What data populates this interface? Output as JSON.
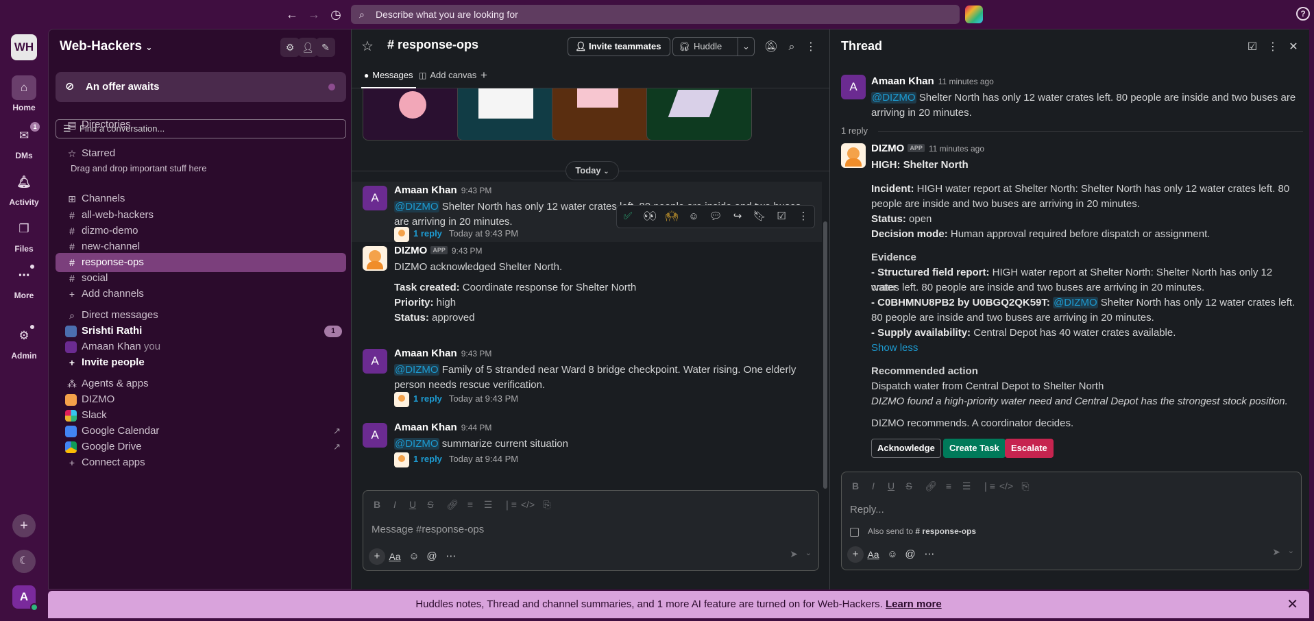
{
  "search": {
    "placeholder": "Describe what you are looking for"
  },
  "workspace": {
    "initials": "WH",
    "name": "Web-Hackers"
  },
  "rail": {
    "home": "Home",
    "dms": "DMs",
    "dms_badge": "1",
    "activity": "Activity",
    "files": "Files",
    "more": "More",
    "admin": "Admin",
    "user_initial": "A"
  },
  "sidebar": {
    "offer": "An offer awaits",
    "find_placeholder": "Find a conversation...",
    "directories": "Directories",
    "starred": "Starred",
    "starred_hint": "Drag and drop important stuff here",
    "channels_header": "Channels",
    "channels": [
      "all-web-hackers",
      "dizmo-demo",
      "new-channel",
      "response-ops",
      "social"
    ],
    "add_channels": "Add channels",
    "dm_header": "Direct messages",
    "dm_srishti": "Srishti Rathi",
    "dm_srishti_badge": "1",
    "dm_amaan": "Amaan Khan",
    "dm_amaan_you": "you",
    "invite_people": "Invite people",
    "apps_header": "Agents & apps",
    "apps": [
      "DIZMO",
      "Slack",
      "Google Calendar",
      "Google Drive"
    ],
    "connect_apps": "Connect apps"
  },
  "channel": {
    "name": "response-ops",
    "invite": "Invite teammates",
    "huddle": "Huddle",
    "tab_messages": "Messages",
    "tab_canvas": "Add canvas",
    "today": "Today",
    "composer_placeholder": "Message #response-ops",
    "messages": [
      {
        "author": "Amaan Khan",
        "time": "9:43 PM",
        "mention": "@DIZMO",
        "text": " Shelter North has only 12 water crates left. 80 people are inside and two buses are arriving in 20 minutes.",
        "replies": "1 reply",
        "reply_time": "Today at 9:43 PM"
      },
      {
        "author": "DIZMO",
        "app": "APP",
        "time": "9:43 PM",
        "line1": "DIZMO acknowledged Shelter North.",
        "task_label": "Task created:",
        "task_value": " Coordinate response for Shelter North",
        "priority_label": "Priority:",
        "priority_value": " high",
        "status_label": "Status:",
        "status_value": " approved"
      },
      {
        "author": "Amaan Khan",
        "time": "9:43 PM",
        "mention": "@DIZMO",
        "text": " Family of 5 stranded near Ward 8 bridge checkpoint. Water rising. One elderly person needs rescue verification.",
        "replies": "1 reply",
        "reply_time": "Today at 9:43 PM"
      },
      {
        "author": "Amaan Khan",
        "time": "9:44 PM",
        "mention": "@DIZMO",
        "text": " summarize current situation",
        "replies": "1 reply",
        "reply_time": "Today at 9:44 PM"
      }
    ]
  },
  "thread": {
    "title": "Thread",
    "parent": {
      "author": "Amaan Khan",
      "time": "11 minutes ago",
      "mention": "@DIZMO",
      "text": " Shelter North has only 12 water crates left. 80 people are inside and two buses are arriving in 20 minutes."
    },
    "reply_count": "1 reply",
    "reply": {
      "author": "DIZMO",
      "app": "APP",
      "time": "11 minutes ago",
      "heading": "HIGH: Shelter North",
      "incident_label": "Incident:",
      "incident_1": " HIGH water report at Shelter North: Shelter North has only 12 water crates left. 80",
      "incident_2": "people are inside and two buses are arriving in 20 minutes.",
      "status_label": "Status:",
      "status_value": " open",
      "decision_label": "Decision mode:",
      "decision_value": " Human approval required before dispatch or assignment.",
      "evidence": "Evidence",
      "ev1_label": "- Structured field report:",
      "ev1_1": " HIGH water report at Shelter North: Shelter North has only 12 water",
      "ev1_2": "crates left. 80 people are inside and two buses are arriving in 20 minutes.",
      "ev2_label": "- C0BHMNU8PB2 by U0BGQ2QK59T:",
      "ev2_mention": "@DIZMO",
      "ev2_1": " Shelter North has only 12 water crates left.",
      "ev2_2": "80 people are inside and two buses are arriving in 20 minutes.",
      "ev3_label": "- Supply availability:",
      "ev3_value": " Central Depot has 40 water crates available.",
      "show_less": "Show less",
      "rec_heading": "Recommended action",
      "rec_text": "Dispatch water from Central Depot to Shelter North",
      "rec_italic": "DIZMO found a high-priority water need and Central Depot has the strongest stock position.",
      "footer": "DIZMO recommends. A coordinator decides.",
      "btn_ack": "Acknowledge",
      "btn_task": "Create Task",
      "btn_esc": "Escalate"
    },
    "reply_placeholder": "Reply...",
    "also_send": "Also send to",
    "also_send_channel": "# response-ops"
  },
  "banner": {
    "text": "Huddles notes, Thread and channel summaries, and 1 more AI feature are turned on for Web-Hackers. ",
    "learn_more": "Learn more"
  }
}
